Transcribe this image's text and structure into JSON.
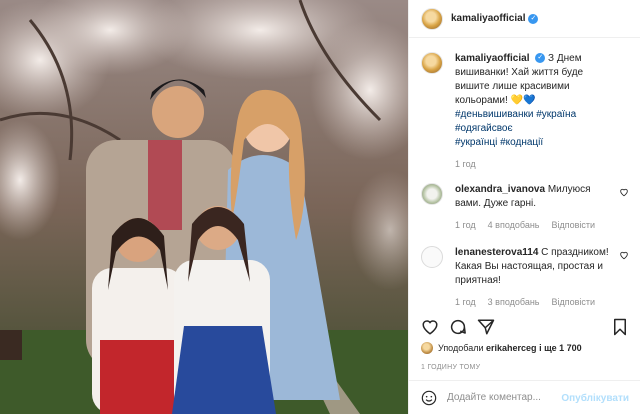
{
  "post": {
    "username": "kamaliyaofficial",
    "image_alt": "Family photo in embroidered shirts under blossoming trees"
  },
  "caption": {
    "username": "kamaliyaofficial",
    "text": "З Днем вишиванки! Хай життя буде вишите лише красивими кольорами!",
    "emoji": "💛💙",
    "hashtags_line1": "#деньвишиванки #україна",
    "hashtags_line2": "#одягайсвоє",
    "hashtags_line3": "#українці #коднації",
    "time": "1 год"
  },
  "comments": [
    {
      "username": "olexandra_ivanova",
      "text": "Милуюся вами. Дуже гарні.",
      "time": "1 год",
      "likes": "4 вподобань",
      "reply": "Відповісти"
    },
    {
      "username": "lenanesterova114",
      "text": "С праздником! Какая Вы настоящая, простая и приятная!",
      "time": "1 год",
      "likes": "3 вподобань",
      "reply": "Відповісти"
    }
  ],
  "likes": {
    "prefix": "Уподобали",
    "user": "erikaherceg",
    "suffix": "і ще 1 700"
  },
  "timestamp": "1 ГОДИНУ ТОМУ",
  "add_comment": {
    "placeholder": "Додайте коментар...",
    "post_label": "Опублікувати"
  },
  "colors": {
    "link": "#00376b",
    "verified": "#3897f0",
    "post_disabled": "#b2dffc",
    "muted": "#8e8e8e"
  }
}
